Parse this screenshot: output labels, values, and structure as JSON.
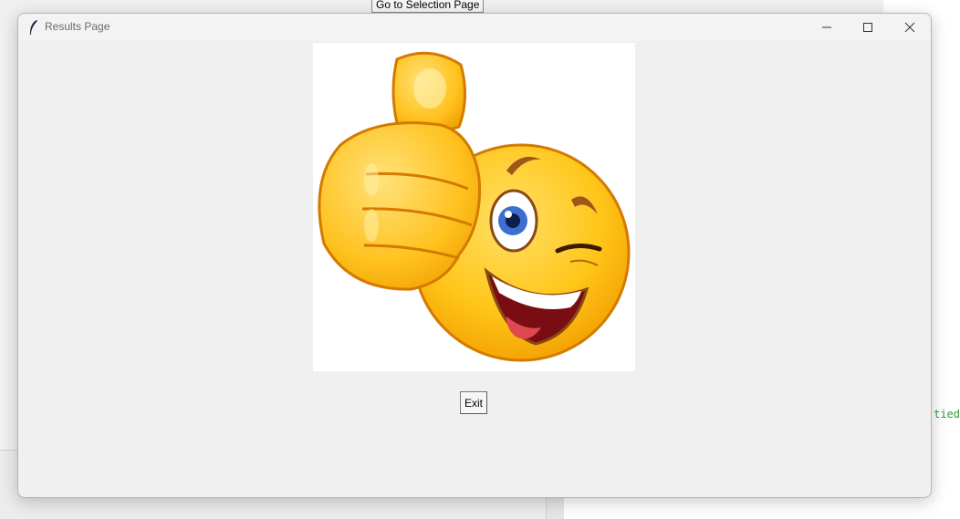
{
  "background": {
    "goto_button_label": "Go to Selection Page",
    "code_fragment": "tied"
  },
  "window": {
    "title": "Results Page",
    "controls": {
      "minimize": "minimize-icon",
      "maximize": "maximize-icon",
      "close": "close-icon"
    }
  },
  "content": {
    "image": "thumbs-up-winking-emoji",
    "exit_label": "Exit"
  },
  "colors": {
    "emoji_yellow": "#FFC61A",
    "emoji_outline": "#D47A00",
    "code_green": "#2E9E3C",
    "window_bg": "#F0F0F0"
  }
}
